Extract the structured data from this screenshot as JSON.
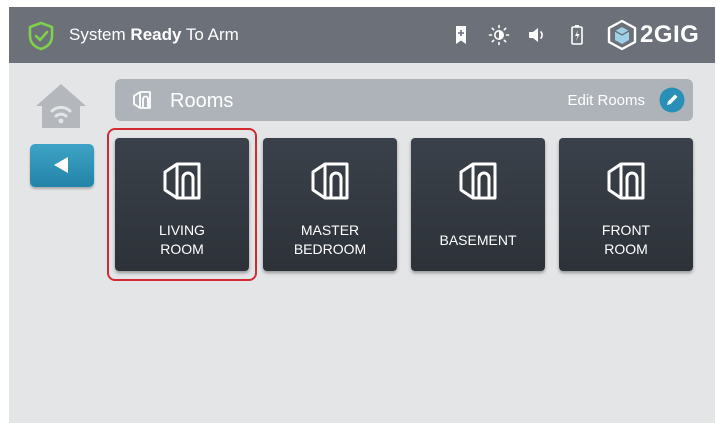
{
  "status": {
    "prefix": "System",
    "state": "Ready",
    "suffix": "To Arm",
    "shield_color": "#7fd04a"
  },
  "topbar_icons": [
    "bookmark-icon",
    "brightness-icon",
    "volume-icon",
    "battery-icon"
  ],
  "brand": {
    "name": "2GIG"
  },
  "header": {
    "title": "Rooms",
    "edit_label": "Edit Rooms"
  },
  "rooms": [
    {
      "label": "LIVING\nROOM",
      "selected": true
    },
    {
      "label": "MASTER\nBEDROOM",
      "selected": false
    },
    {
      "label": "BASEMENT",
      "selected": false
    },
    {
      "label": "FRONT\nROOM",
      "selected": false
    }
  ],
  "colors": {
    "accent": "#2a8fb6",
    "selected_outline": "#d32b31",
    "tile": "#343a42"
  }
}
